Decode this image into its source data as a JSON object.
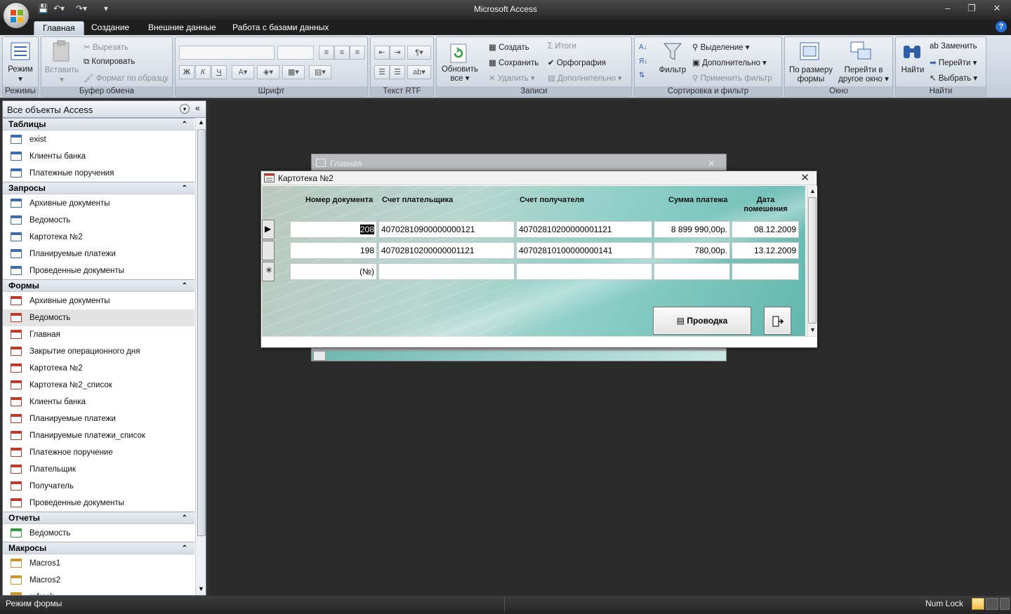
{
  "window": {
    "title": "Microsoft Access"
  },
  "ribbon_tabs": [
    "Главная",
    "Создание",
    "Внешние данные",
    "Работа с базами данных"
  ],
  "ribbon": {
    "modes": {
      "view_label": "Режим",
      "group_label": "Режимы"
    },
    "clipboard": {
      "cut": "Вырезать",
      "copy": "Копировать",
      "format_painter": "Формат по образцу",
      "paste": "Вставить",
      "group_label": "Буфер обмена"
    },
    "font": {
      "bold": "Ж",
      "italic": "К",
      "underline": "Ч",
      "group_label": "Шрифт"
    },
    "rtf": {
      "group_label": "Текст RTF"
    },
    "records": {
      "refresh": "Обновить",
      "refresh2": "все",
      "new": "Создать",
      "save": "Сохранить",
      "delete": "Удалить",
      "totals": "Итоги",
      "spelling": "Орфография",
      "more": "Дополнительно",
      "group_label": "Записи"
    },
    "sort_filter": {
      "filter": "Фильтр",
      "selection": "Выделение",
      "advanced": "Дополнительно",
      "toggle_filter": "Применить фильтр",
      "group_label": "Сортировка и фильтр"
    },
    "window": {
      "fit_form": "По размеру",
      "fit_form2": "формы",
      "switch_window": "Перейти в",
      "switch_window2": "другое окно",
      "group_label": "Окно"
    },
    "find": {
      "find": "Найти",
      "replace": "Заменить",
      "goto": "Перейти",
      "select": "Выбрать",
      "group_label": "Найти"
    }
  },
  "nav": {
    "title": "Все объекты Access",
    "sections": [
      {
        "name": "Таблицы",
        "items": [
          "exist",
          "Клиенты банка",
          "Платежные поручения"
        ]
      },
      {
        "name": "Запросы",
        "items": [
          "Архивные документы",
          "Ведомость",
          "Картотека №2",
          "Планируемые платежи",
          "Проведенные документы"
        ]
      },
      {
        "name": "Формы",
        "items": [
          "Архивные документы",
          "Ведомость",
          "Главная",
          "Закрытие операционного дня",
          "Картотека №2",
          "Картотека №2_список",
          "Клиенты банка",
          "Планируемые платежи",
          "Планируемые платежи_список",
          "Платежное поручение",
          "Плательщик",
          "Получатель",
          "Проведенные документы"
        ]
      },
      {
        "name": "Отчеты",
        "items": [
          "Ведомость"
        ]
      },
      {
        "name": "Макросы",
        "items": [
          "Macros1",
          "Macros2",
          "refresh"
        ]
      }
    ]
  },
  "back_window": {
    "title": "Главная"
  },
  "form": {
    "title": "Картотека №2",
    "columns": [
      "Номер документа",
      "Счет плательщика",
      "Счет получателя",
      "Сумма платежа",
      "Дата помешения"
    ],
    "rows": [
      {
        "num": "208",
        "payer": "40702810900000000121",
        "payee": "40702810200000001121",
        "sum": "8 899 990,00р.",
        "date": "08.12.2009"
      },
      {
        "num": "198",
        "payer": "40702810200000001121",
        "payee": "40702810100000000141",
        "sum": "780,00р.",
        "date": "13.12.2009"
      }
    ],
    "new_row_num": "(№)",
    "post_button": "Проводка"
  },
  "status": {
    "left": "Режим формы",
    "numlock": "Num Lock"
  }
}
